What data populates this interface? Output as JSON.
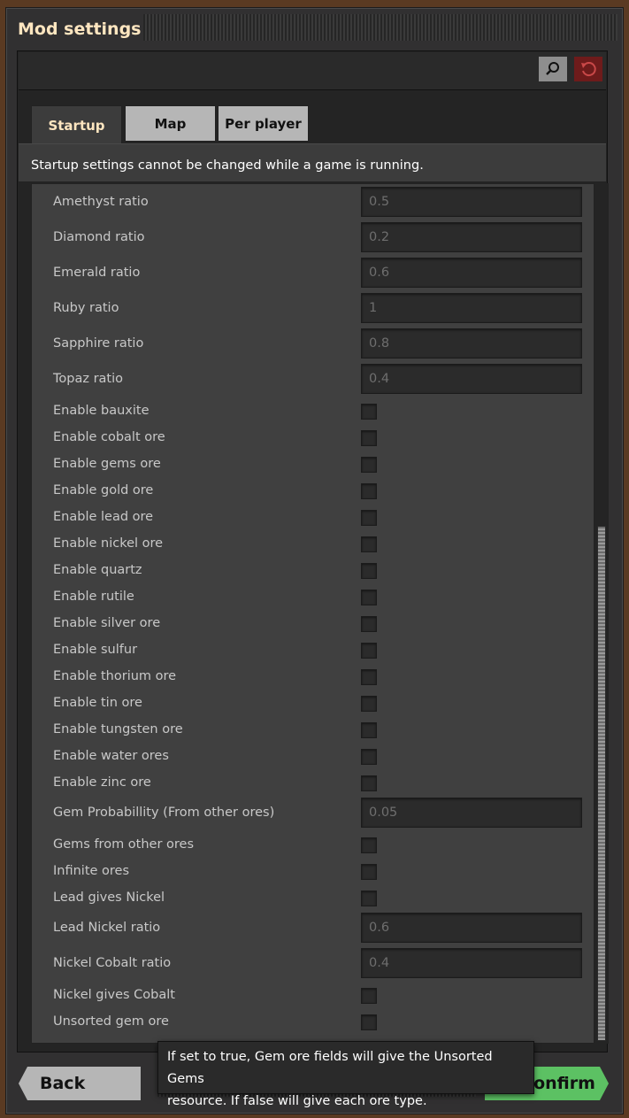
{
  "window": {
    "title": "Mod settings"
  },
  "toolbar": {
    "search_icon": "search-icon",
    "reset_icon": "reset-icon"
  },
  "tabs": [
    {
      "label": "Startup",
      "active": true
    },
    {
      "label": "Map",
      "active": false
    },
    {
      "label": "Per player",
      "active": false
    }
  ],
  "notice": "Startup settings cannot be changed while a game is running.",
  "settings": [
    {
      "label": "Amethyst ratio",
      "type": "number",
      "value": "0.5"
    },
    {
      "label": "Diamond ratio",
      "type": "number",
      "value": "0.2"
    },
    {
      "label": "Emerald ratio",
      "type": "number",
      "value": "0.6"
    },
    {
      "label": "Ruby ratio",
      "type": "number",
      "value": "1"
    },
    {
      "label": "Sapphire ratio",
      "type": "number",
      "value": "0.8"
    },
    {
      "label": "Topaz ratio",
      "type": "number",
      "value": "0.4"
    },
    {
      "label": "Enable bauxite",
      "type": "checkbox",
      "checked": false
    },
    {
      "label": "Enable cobalt ore",
      "type": "checkbox",
      "checked": false
    },
    {
      "label": "Enable gems ore",
      "type": "checkbox",
      "checked": false
    },
    {
      "label": "Enable gold ore",
      "type": "checkbox",
      "checked": false
    },
    {
      "label": "Enable lead ore",
      "type": "checkbox",
      "checked": false
    },
    {
      "label": "Enable nickel ore",
      "type": "checkbox",
      "checked": false
    },
    {
      "label": "Enable quartz",
      "type": "checkbox",
      "checked": false
    },
    {
      "label": "Enable rutile",
      "type": "checkbox",
      "checked": false
    },
    {
      "label": "Enable silver ore",
      "type": "checkbox",
      "checked": false
    },
    {
      "label": "Enable sulfur",
      "type": "checkbox",
      "checked": false
    },
    {
      "label": "Enable thorium ore",
      "type": "checkbox",
      "checked": false
    },
    {
      "label": "Enable tin ore",
      "type": "checkbox",
      "checked": false
    },
    {
      "label": "Enable tungsten ore",
      "type": "checkbox",
      "checked": false
    },
    {
      "label": "Enable water ores",
      "type": "checkbox",
      "checked": false
    },
    {
      "label": "Enable zinc ore",
      "type": "checkbox",
      "checked": false
    },
    {
      "label": "Gem Probabillity (From other ores)",
      "type": "number",
      "value": "0.05"
    },
    {
      "label": "Gems from other ores",
      "type": "checkbox",
      "checked": false
    },
    {
      "label": "Infinite ores",
      "type": "checkbox",
      "checked": false
    },
    {
      "label": "Lead gives Nickel",
      "type": "checkbox",
      "checked": false
    },
    {
      "label": "Lead Nickel ratio",
      "type": "number",
      "value": "0.6"
    },
    {
      "label": "Nickel Cobalt ratio",
      "type": "number",
      "value": "0.4"
    },
    {
      "label": "Nickel gives Cobalt",
      "type": "checkbox",
      "checked": false
    },
    {
      "label": "Unsorted gem ore",
      "type": "checkbox",
      "checked": false
    }
  ],
  "footer": {
    "back_label": "Back",
    "confirm_label": "onfirm"
  },
  "tooltip": {
    "line1": "If set to true, Gem ore fields will give the Unsorted Gems",
    "line2": "resource. If false will give each ore type."
  }
}
